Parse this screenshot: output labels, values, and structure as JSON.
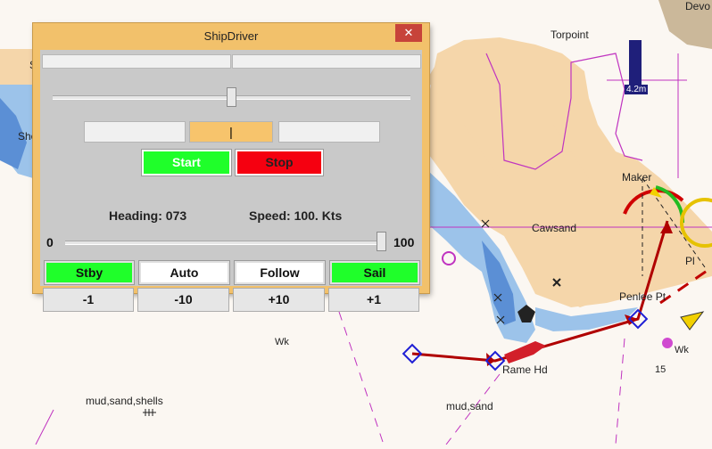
{
  "map": {
    "labels": {
      "torpoint": "Torpoint",
      "devo": "Devo",
      "maker": "Maker",
      "cawsand": "Cawsand",
      "penlee": "Penlee Pt",
      "rame": "Rame Hd",
      "mud_sand_shells": "mud,sand,shells",
      "mud_sand": "mud,sand",
      "wk1": "Wk",
      "wk2": "Wk",
      "she": "She",
      "s": "S",
      "pl": "Pl",
      "fifteen": "15",
      "depth_4_2": "4.2m"
    },
    "colors": {
      "land": "#f5d6aa",
      "sea": "#fbf7f2",
      "shallow": "#9cc3ea",
      "deep": "#5b8fd5",
      "route": "#c00000",
      "boundary": "#c033c0"
    }
  },
  "dialog": {
    "title": "ShipDriver",
    "close_icon": "close-icon",
    "rudder_value": "|",
    "start_label": "Start",
    "stop_label": "Stop",
    "heading_label": "Heading:",
    "heading_value": "073",
    "speed_label": "Speed:",
    "speed_value": "100.",
    "speed_unit": "Kts",
    "throttle_min": "0",
    "throttle_max": "100",
    "throttle_level": 1.0,
    "helm_position": 0.5,
    "modes": [
      {
        "label": "Stby",
        "bg": "#1fff2a"
      },
      {
        "label": "Auto",
        "bg": "#ffffff"
      },
      {
        "label": "Follow",
        "bg": "#ffffff"
      },
      {
        "label": "Sail",
        "bg": "#1fff2a"
      }
    ],
    "steps": [
      "-1",
      "-10",
      "+10",
      "+1"
    ],
    "colors": {
      "frame": "#f2c16b",
      "client": "#c9c9c9",
      "start": "#1fff2a",
      "stop": "#f50010",
      "rudder": "#f7c46c",
      "close": "#c7433a"
    }
  }
}
